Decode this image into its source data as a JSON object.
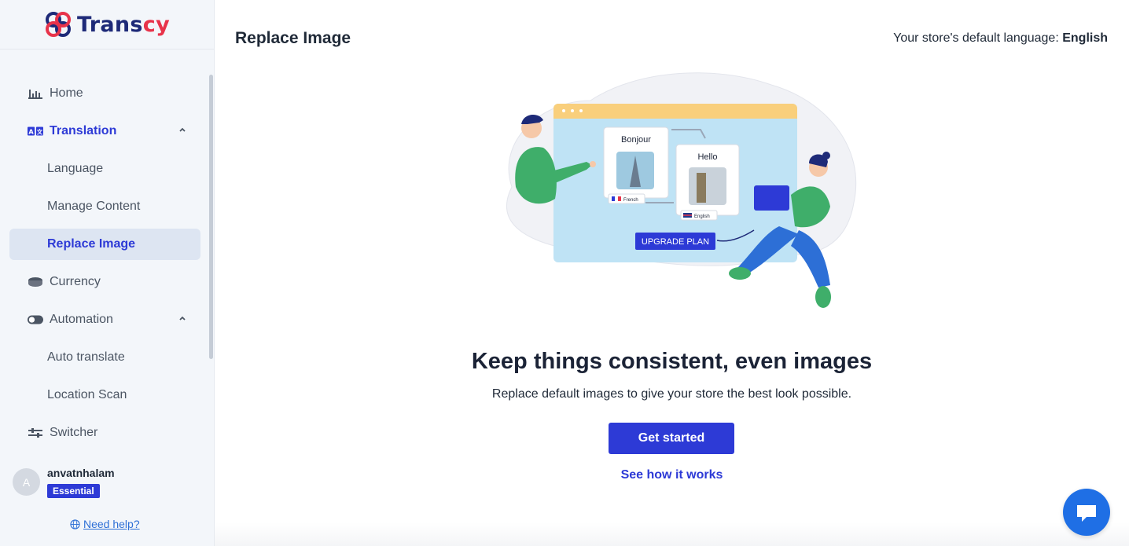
{
  "app": {
    "name_prefix": "Trans",
    "name_suffix": "cy",
    "brand_color": "#2d3ad6",
    "accent_color": "#e8334a"
  },
  "sidebar": {
    "items": [
      {
        "label": "Home",
        "icon": "bar-chart-icon"
      },
      {
        "label": "Translation",
        "icon": "translate-icon",
        "expanded": true
      },
      {
        "label": "Language"
      },
      {
        "label": "Manage Content"
      },
      {
        "label": "Replace Image",
        "selected": true
      },
      {
        "label": "Currency",
        "icon": "coins-icon"
      },
      {
        "label": "Automation",
        "icon": "toggle-icon",
        "expanded": true
      },
      {
        "label": "Auto translate"
      },
      {
        "label": "Location Scan"
      },
      {
        "label": "Switcher",
        "icon": "sliders-icon"
      }
    ]
  },
  "user": {
    "initial": "A",
    "name": "anvatnhalam",
    "plan": "Essential"
  },
  "help": {
    "label": "Need help?"
  },
  "header": {
    "title": "Replace Image",
    "lang_prefix": "Your store's default language:",
    "lang_value": "English"
  },
  "illustration": {
    "word_source": "Bonjour",
    "word_target": "Hello",
    "flag_source": "French",
    "flag_target": "English",
    "upgrade": "UPGRADE PLAN"
  },
  "main": {
    "headline": "Keep things consistent, even images",
    "subline": "Replace default images to give your store the best look possible.",
    "cta": "Get started",
    "link": "See how it works"
  }
}
